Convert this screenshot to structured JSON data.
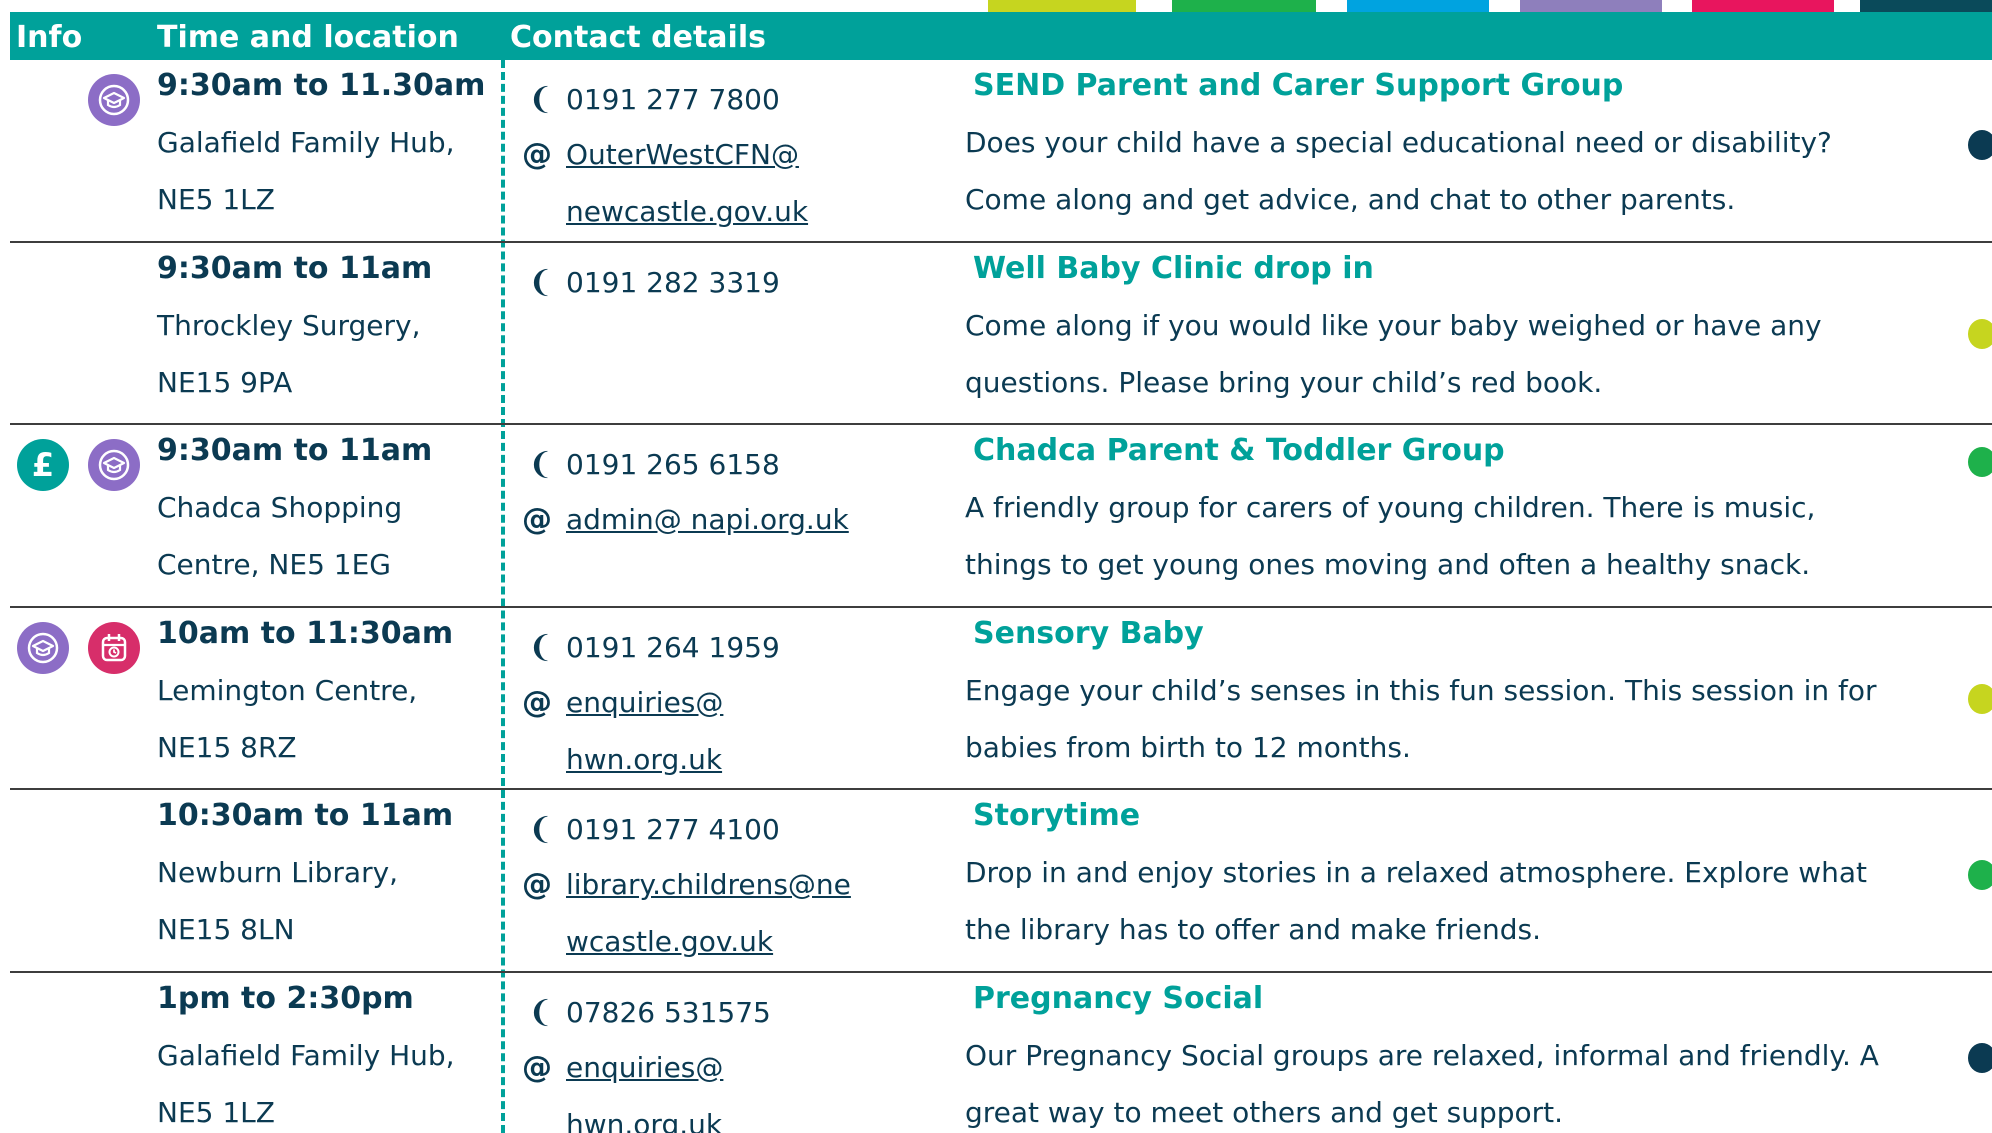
{
  "colors": {
    "teal": "#00a19a",
    "navy": "#0b3a52",
    "purple": "#8c6dc6",
    "pink": "#d72e6a",
    "lime": "#c6d51f",
    "green": "#1eb14b",
    "blue": "#00a3e0",
    "lavender": "#8e7fbc",
    "magenta": "#e8155e",
    "dark_teal": "#0a4a5a"
  },
  "header": {
    "info": "Info",
    "time": "Time and location",
    "contact": "Contact details"
  },
  "rows": [
    {
      "icons": [
        "graduation-cap-icon"
      ],
      "time": "9:30am to 11.30am",
      "location_lines": [
        "Galafield Family Hub,",
        "NE5 1LZ"
      ],
      "phone": "0191 277 7800",
      "email_lines": [
        "OuterWestCFN@",
        "newcastle.gov.uk"
      ],
      "title": "SEND Parent and Carer Support Group",
      "description_lines": [
        "Does your child have a special educational need or disability?",
        "Come along and get advice, and chat to other parents."
      ],
      "dot_color": "#0b3a52"
    },
    {
      "icons": [],
      "time": "9:30am to 11am",
      "location_lines": [
        "Throckley Surgery,",
        "NE15 9PA"
      ],
      "phone": "0191 282 3319",
      "email_lines": [],
      "title": "Well Baby Clinic drop in",
      "description_lines": [
        "Come along if you would like your baby weighed or have any",
        "questions. Please bring your child’s red book."
      ],
      "dot_color": "#c6d51f"
    },
    {
      "icons": [
        "pound-icon",
        "graduation-cap-icon"
      ],
      "time": "9:30am to 11am",
      "location_lines": [
        "Chadca Shopping",
        "Centre, NE5 1EG"
      ],
      "phone": "0191 265 6158",
      "email_lines": [
        "admin@ napi.org.uk"
      ],
      "title": "Chadca Parent & Toddler Group",
      "description_lines": [
        "A friendly group for carers of young children. There is music,",
        "things to get young ones moving and often a healthy snack."
      ],
      "dot_color": "#1eb14b"
    },
    {
      "icons": [
        "graduation-cap-icon",
        "calendar-icon"
      ],
      "time": "10am to 11:30am",
      "location_lines": [
        "Lemington Centre,",
        "NE15 8RZ"
      ],
      "phone": "0191 264 1959",
      "email_lines": [
        "enquiries@",
        "hwn.org.uk"
      ],
      "title": "Sensory Baby",
      "description_lines": [
        "Engage your child’s senses in this fun session. This session in for",
        "babies from birth to 12 months."
      ],
      "dot_color": "#c6d51f"
    },
    {
      "icons": [],
      "time": "10:30am to 11am",
      "location_lines": [
        "Newburn Library,",
        "NE15 8LN"
      ],
      "phone": "0191 277 4100",
      "email_lines": [
        "library.childrens@ne",
        "wcastle.gov.uk"
      ],
      "title": "Storytime",
      "description_lines": [
        "Drop in and enjoy stories in a relaxed atmosphere. Explore what",
        "the library has to offer and make friends."
      ],
      "dot_color": "#1eb14b"
    },
    {
      "icons": [],
      "time": "1pm to 2:30pm",
      "location_lines": [
        "Galafield Family Hub,",
        "NE5 1LZ"
      ],
      "phone": "07826 531575",
      "email_lines": [
        "enquiries@",
        "hwn.org.uk"
      ],
      "title": "Pregnancy Social",
      "description_lines": [
        "Our Pregnancy Social groups are relaxed, informal and friendly. A",
        "great way to meet others and get support."
      ],
      "dot_color": "#0b3a52"
    }
  ]
}
